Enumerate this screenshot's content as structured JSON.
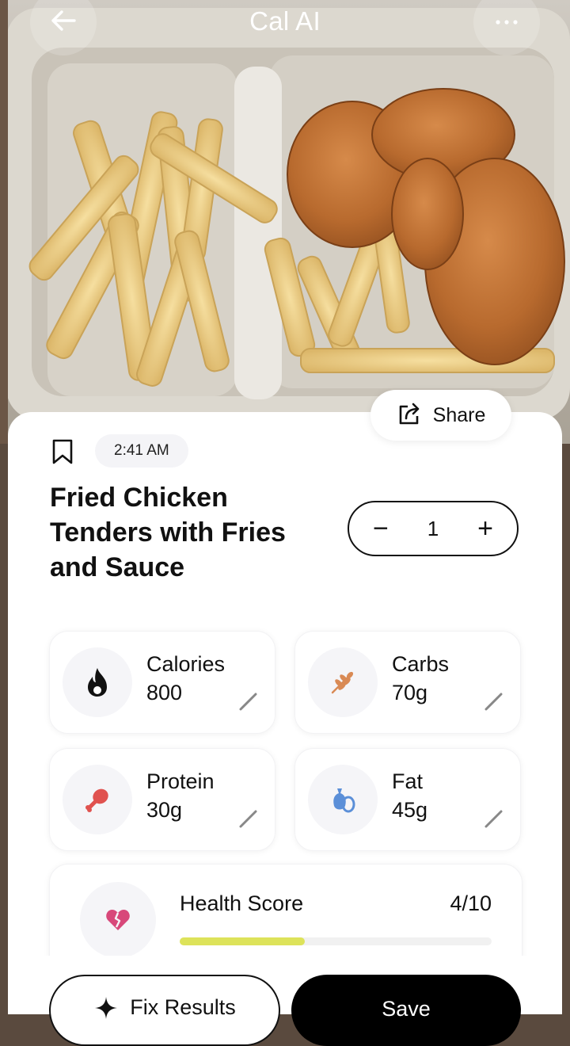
{
  "header": {
    "title": "Cal AI"
  },
  "share": {
    "label": "Share"
  },
  "meal": {
    "time": "2:41 AM",
    "title": "Fried Chicken Tenders with Fries and Sauce",
    "quantity": "1"
  },
  "stepper": {
    "minus": "−",
    "plus": "+"
  },
  "macros": {
    "calories": {
      "label": "Calories",
      "value": "800"
    },
    "carbs": {
      "label": "Carbs",
      "value": "70g"
    },
    "protein": {
      "label": "Protein",
      "value": "30g"
    },
    "fat": {
      "label": "Fat",
      "value": "45g"
    }
  },
  "health": {
    "label": "Health Score",
    "score": "4/10",
    "fraction": 0.4
  },
  "actions": {
    "fix_label": "Fix Results",
    "save_label": "Save"
  },
  "icons": {
    "back": "arrow-left-icon",
    "more": "more-dots-icon",
    "share": "share-icon",
    "bookmark": "bookmark-icon",
    "calories": "flame-icon",
    "carbs": "wheat-icon",
    "protein": "drumstick-icon",
    "fat": "oil-drop-icon",
    "health": "broken-heart-icon",
    "fix": "sparkle-icon",
    "edit": "pencil-icon"
  },
  "colors": {
    "accent": "#000000",
    "health_bar": "#dde35a",
    "protein_icon": "#e0524f",
    "fat_icon": "#5b8fd8",
    "carbs_icon": "#d98a55",
    "heart_icon": "#d8487a"
  }
}
